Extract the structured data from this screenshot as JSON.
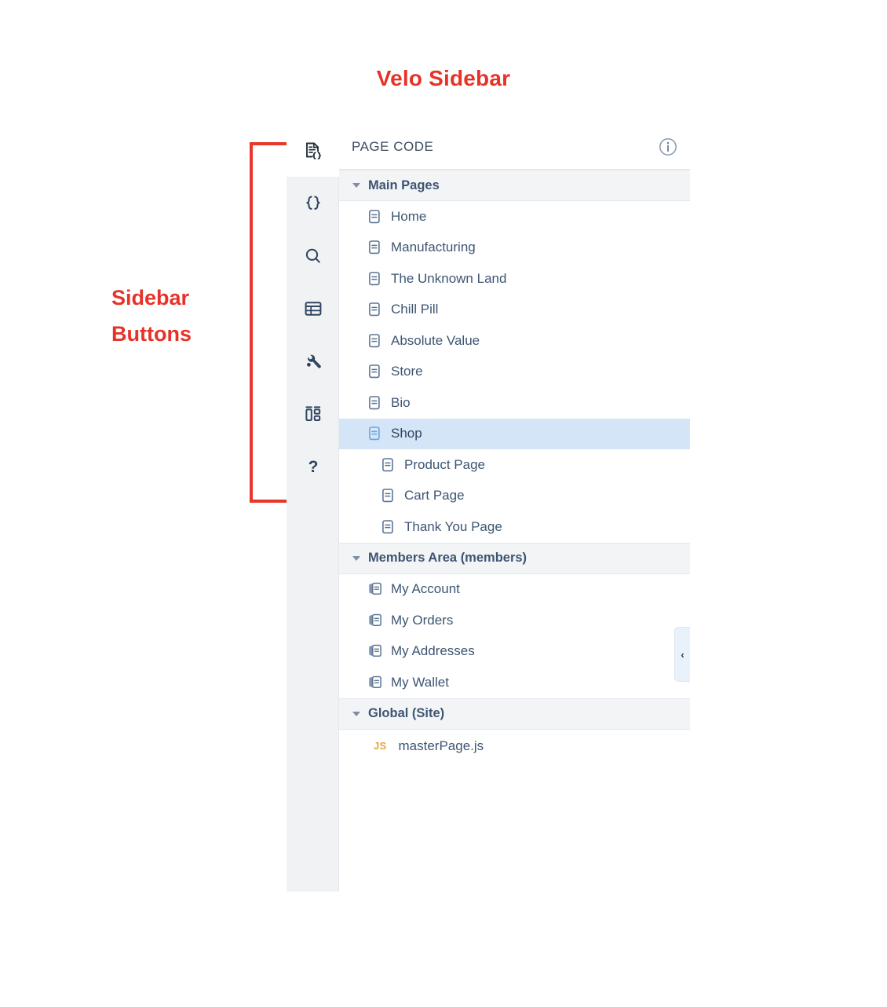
{
  "annotations": {
    "title": "Velo Sidebar",
    "sidebar_buttons_label_line1": "Sidebar",
    "sidebar_buttons_label_line2": "Buttons",
    "accent_color": "#e63329"
  },
  "panel": {
    "header": {
      "title": "PAGE CODE",
      "info_icon": "info-icon"
    },
    "collapse_handle": {
      "icon": "chevron-left-icon",
      "glyph": "‹"
    }
  },
  "rail": {
    "items": [
      {
        "name": "page-code-icon",
        "active": true
      },
      {
        "name": "site-code-icon",
        "active": false
      },
      {
        "name": "search-icon",
        "active": false
      },
      {
        "name": "database-icon",
        "active": false
      },
      {
        "name": "tools-icon",
        "active": false
      },
      {
        "name": "packages-icon",
        "active": false
      },
      {
        "name": "help-icon",
        "active": false
      }
    ]
  },
  "tree": {
    "sections": [
      {
        "label": "Main Pages",
        "expanded": true,
        "items": [
          {
            "label": "Home",
            "icon": "page-icon",
            "indent": 0,
            "selected": false
          },
          {
            "label": "Manufacturing",
            "icon": "page-icon",
            "indent": 0,
            "selected": false
          },
          {
            "label": "The Unknown Land",
            "icon": "page-icon",
            "indent": 0,
            "selected": false
          },
          {
            "label": "Chill Pill",
            "icon": "page-icon",
            "indent": 0,
            "selected": false
          },
          {
            "label": "Absolute Value",
            "icon": "page-icon",
            "indent": 0,
            "selected": false
          },
          {
            "label": "Store",
            "icon": "page-icon",
            "indent": 0,
            "selected": false
          },
          {
            "label": "Bio",
            "icon": "page-icon",
            "indent": 0,
            "selected": false
          },
          {
            "label": "Shop",
            "icon": "page-icon",
            "indent": 0,
            "selected": true
          },
          {
            "label": "Product Page",
            "icon": "page-icon",
            "indent": 1,
            "selected": false
          },
          {
            "label": "Cart Page",
            "icon": "page-icon",
            "indent": 1,
            "selected": false
          },
          {
            "label": "Thank You Page",
            "icon": "page-icon",
            "indent": 1,
            "selected": false
          }
        ]
      },
      {
        "label": "Members Area (members)",
        "expanded": true,
        "items": [
          {
            "label": "My Account",
            "icon": "pages-stack-icon",
            "indent": 0,
            "selected": false
          },
          {
            "label": "My Orders",
            "icon": "pages-stack-icon",
            "indent": 0,
            "selected": false
          },
          {
            "label": "My Addresses",
            "icon": "pages-stack-icon",
            "indent": 0,
            "selected": false
          },
          {
            "label": "My Wallet",
            "icon": "pages-stack-icon",
            "indent": 0,
            "selected": false
          }
        ]
      },
      {
        "label": "Global (Site)",
        "expanded": true,
        "files": [
          {
            "badge": "JS",
            "label": "masterPage.js"
          }
        ]
      }
    ]
  },
  "colors": {
    "selected_row_bg": "#d4e5f8",
    "selected_icon": "#6aa5e0",
    "text": "#3d5573",
    "rail_bg": "#f1f2f4",
    "section_bg": "#f3f4f6",
    "tab_indicator": "#5b9ae0",
    "js_badge": "#e8a33d"
  }
}
